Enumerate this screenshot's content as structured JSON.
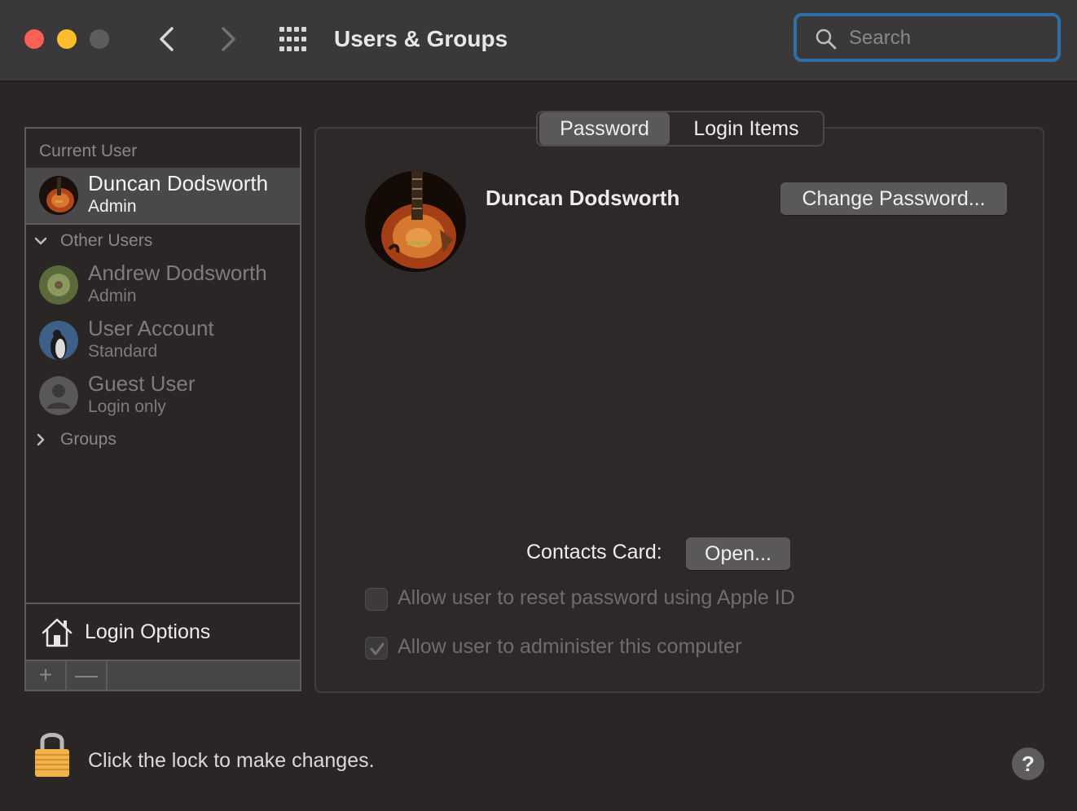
{
  "window": {
    "title": "Users & Groups",
    "search_placeholder": "Search"
  },
  "sidebar": {
    "current_user_title": "Current User",
    "current_user": {
      "name": "Duncan Dodsworth",
      "role": "Admin",
      "avatar": "guitar-avatar"
    },
    "other_users_title": "Other Users",
    "other_users": [
      {
        "name": "Andrew Dodsworth",
        "role": "Admin",
        "avatar": "dandelion-avatar"
      },
      {
        "name": "User Account",
        "role": "Standard",
        "avatar": "penguin-avatar"
      },
      {
        "name": "Guest User",
        "role": "Login only",
        "avatar": "generic-person-avatar"
      }
    ],
    "groups_title": "Groups",
    "login_options": "Login Options",
    "add_label": "+",
    "remove_label": "—"
  },
  "main": {
    "tabs": [
      {
        "label": "Password",
        "selected": true
      },
      {
        "label": "Login Items",
        "selected": false
      }
    ],
    "user_name": "Duncan Dodsworth",
    "change_password_label": "Change Password...",
    "contacts_card_label": "Contacts Card:",
    "open_label": "Open...",
    "checkboxes": [
      {
        "label": "Allow user to reset password using Apple ID",
        "checked": false,
        "enabled": false
      },
      {
        "label": "Allow user to administer this computer",
        "checked": true,
        "enabled": false
      }
    ]
  },
  "footer": {
    "lock_text": "Click the lock to make changes.",
    "help_label": "?"
  },
  "colors": {
    "background": "#2a2625",
    "titlebar": "#3a3838",
    "selection": "#4a4848",
    "search_focus_ring": "#2f6fa8",
    "close": "#fe5f57",
    "minimize": "#febc2e",
    "zoom_disabled": "#5e5c5c"
  }
}
